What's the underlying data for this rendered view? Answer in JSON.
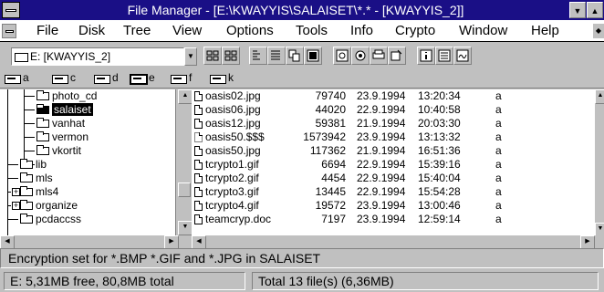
{
  "window": {
    "title": "File Manager - [E:\\KWAYYIS\\SALAISET\\*.* - [KWAYYIS_2]]"
  },
  "menu": {
    "items": [
      {
        "label": "File",
        "name": "menu-file"
      },
      {
        "label": "Disk",
        "name": "menu-disk"
      },
      {
        "label": "Tree",
        "name": "menu-tree"
      },
      {
        "label": "View",
        "name": "menu-view"
      },
      {
        "label": "Options",
        "name": "menu-options"
      },
      {
        "label": "Tools",
        "name": "menu-tools"
      },
      {
        "label": "Info",
        "name": "menu-info"
      },
      {
        "label": "Crypto",
        "name": "menu-crypto"
      },
      {
        "label": "Window",
        "name": "menu-window"
      },
      {
        "label": "Help",
        "name": "menu-help"
      }
    ]
  },
  "toolbar": {
    "drive_selected": "E: [KWAYYIS_2]"
  },
  "drives": [
    {
      "letter": "a"
    },
    {
      "letter": "c"
    },
    {
      "letter": "d"
    },
    {
      "letter": "e"
    },
    {
      "letter": "f"
    },
    {
      "letter": "k"
    }
  ],
  "tree": {
    "items": [
      {
        "label": "photo_cd"
      },
      {
        "label": "salaiset"
      },
      {
        "label": "vanhat"
      },
      {
        "label": "vermon"
      },
      {
        "label": "vkortit"
      },
      {
        "label": "lib"
      },
      {
        "label": "mls"
      },
      {
        "label": "mls4"
      },
      {
        "label": "organize"
      },
      {
        "label": "pcdaccss"
      }
    ]
  },
  "files": [
    {
      "name": "oasis02.jpg",
      "size": "79740",
      "date": "23.9.1994",
      "time": "13:20:34",
      "attr": "a"
    },
    {
      "name": "oasis06.jpg",
      "size": "44020",
      "date": "22.9.1994",
      "time": "10:40:58",
      "attr": "a"
    },
    {
      "name": "oasis12.jpg",
      "size": "59381",
      "date": "21.9.1994",
      "time": "20:03:30",
      "attr": "a"
    },
    {
      "name": "oasis50.$$$",
      "size": "1573942",
      "date": "23.9.1994",
      "time": "13:13:32",
      "attr": "a"
    },
    {
      "name": "oasis50.jpg",
      "size": "117362",
      "date": "21.9.1994",
      "time": "16:51:36",
      "attr": "a"
    },
    {
      "name": "tcrypto1.gif",
      "size": "6694",
      "date": "22.9.1994",
      "time": "15:39:16",
      "attr": "a"
    },
    {
      "name": "tcrypto2.gif",
      "size": "4454",
      "date": "22.9.1994",
      "time": "15:40:04",
      "attr": "a"
    },
    {
      "name": "tcrypto3.gif",
      "size": "13445",
      "date": "22.9.1994",
      "time": "15:54:28",
      "attr": "a"
    },
    {
      "name": "tcrypto4.gif",
      "size": "19572",
      "date": "23.9.1994",
      "time": "13:00:46",
      "attr": "a"
    },
    {
      "name": "teamcryp.doc",
      "size": "7197",
      "date": "23.9.1994",
      "time": "12:59:14",
      "attr": "a"
    }
  ],
  "status": {
    "message": "Encryption set for *.BMP *.GIF and *.JPG in SALAISET",
    "free": "E: 5,31MB free,  80,8MB total",
    "total": "Total 13 file(s) (6,36MB)"
  }
}
